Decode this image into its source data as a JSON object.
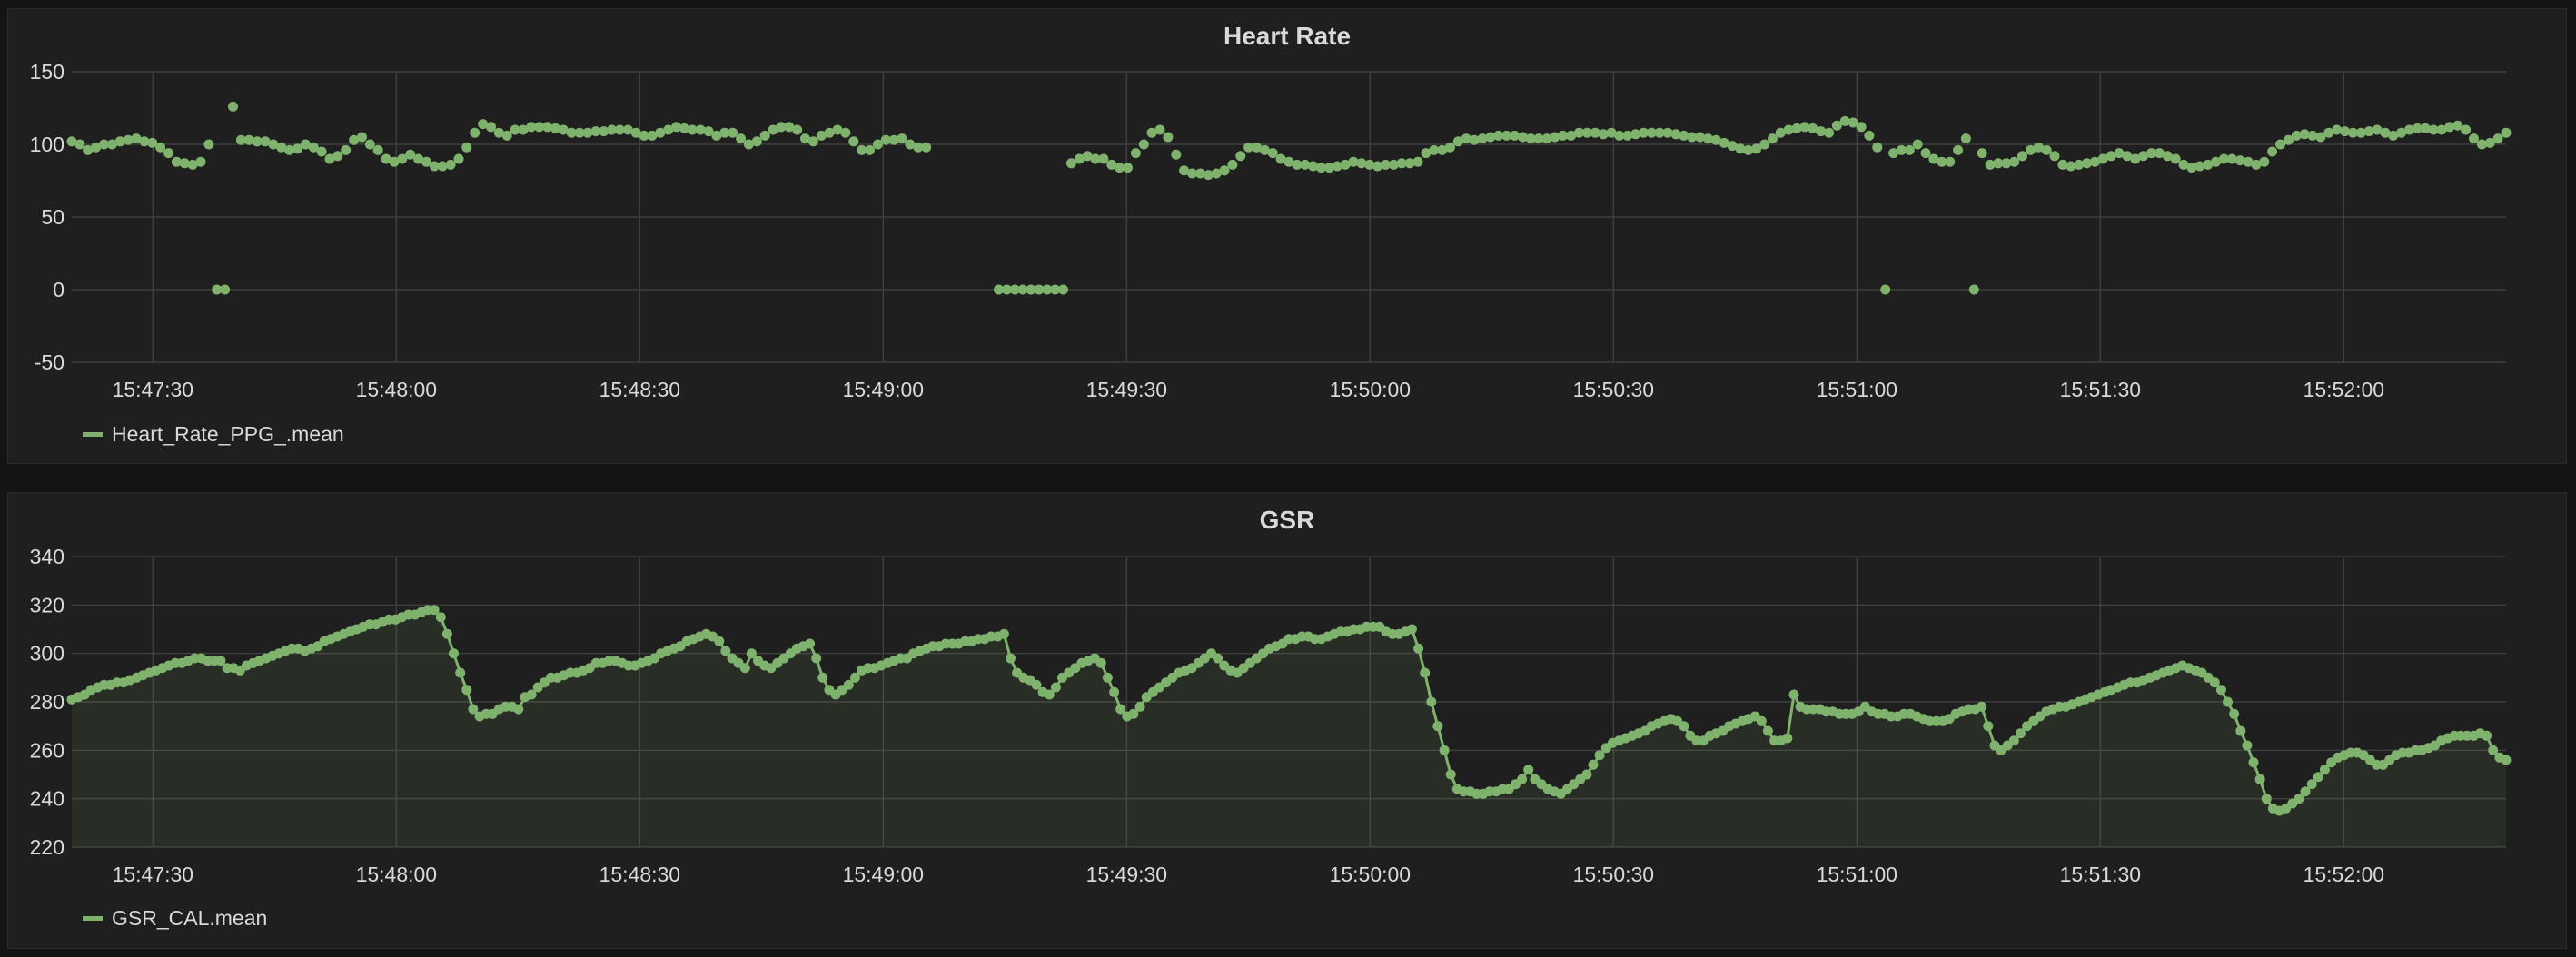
{
  "chart_data": [
    {
      "type": "scatter",
      "title": "Heart Rate",
      "ylim": [
        -50,
        150
      ],
      "yticks": [
        "150",
        "100",
        "50",
        "0",
        "-50"
      ],
      "xticks": [
        "15:47:30",
        "15:48:00",
        "15:48:30",
        "15:49:00",
        "15:49:30",
        "15:50:00",
        "15:50:30",
        "15:51:00",
        "15:51:30",
        "15:52:00"
      ],
      "x_start": "15:47:20",
      "x_end": "15:52:20",
      "grid": true,
      "legend_position": "bottom-left",
      "series": [
        {
          "name": "Heart_Rate_PPG_.mean",
          "color": "#7eb26d",
          "values": [
            102,
            100,
            96,
            98,
            100,
            100,
            102,
            103,
            104,
            102,
            101,
            98,
            94,
            88,
            87,
            86,
            88,
            100,
            0,
            0,
            126,
            103,
            103,
            102,
            102,
            100,
            98,
            96,
            97,
            100,
            98,
            95,
            90,
            92,
            96,
            103,
            105,
            100,
            96,
            90,
            88,
            90,
            93,
            90,
            88,
            85,
            85,
            86,
            90,
            98,
            108,
            114,
            112,
            108,
            106,
            110,
            110,
            112,
            112,
            112,
            111,
            110,
            108,
            108,
            108,
            109,
            109,
            110,
            110,
            110,
            108,
            106,
            106,
            108,
            110,
            112,
            111,
            110,
            110,
            109,
            106,
            108,
            108,
            104,
            100,
            102,
            106,
            110,
            112,
            112,
            110,
            104,
            102,
            106,
            108,
            110,
            108,
            102,
            96,
            96,
            100,
            103,
            103,
            104,
            100,
            98,
            98,
            null,
            null,
            null,
            null,
            null,
            null,
            null,
            null,
            0,
            0,
            0,
            0,
            0,
            0,
            0,
            0,
            0,
            87,
            90,
            92,
            90,
            90,
            86,
            84,
            84,
            94,
            100,
            108,
            110,
            105,
            93,
            82,
            80,
            80,
            79,
            80,
            82,
            86,
            92,
            98,
            98,
            96,
            94,
            90,
            88,
            86,
            86,
            85,
            84,
            84,
            85,
            86,
            88,
            87,
            86,
            85,
            86,
            86,
            87,
            87,
            88,
            94,
            96,
            96,
            98,
            102,
            104,
            103,
            104,
            105,
            106,
            106,
            106,
            105,
            104,
            104,
            104,
            105,
            106,
            106,
            108,
            108,
            108,
            107,
            108,
            106,
            106,
            107,
            108,
            108,
            108,
            108,
            107,
            106,
            105,
            105,
            104,
            103,
            101,
            99,
            97,
            96,
            97,
            100,
            104,
            108,
            110,
            111,
            112,
            111,
            109,
            108,
            113,
            116,
            115,
            112,
            106,
            98,
            0,
            94,
            96,
            96,
            100,
            94,
            90,
            88,
            88,
            96,
            104,
            0,
            94,
            86,
            87,
            87,
            88,
            92,
            96,
            98,
            96,
            92,
            86,
            85,
            86,
            87,
            88,
            90,
            92,
            94,
            92,
            90,
            92,
            94,
            94,
            92,
            90,
            86,
            84,
            85,
            86,
            88,
            90,
            90,
            89,
            88,
            86,
            88,
            95,
            100,
            103,
            106,
            107,
            106,
            105,
            108,
            110,
            109,
            108,
            108,
            109,
            110,
            108,
            106,
            108,
            110,
            111,
            111,
            110,
            110,
            112,
            113,
            110,
            104,
            100,
            101,
            104,
            108
          ]
        }
      ]
    },
    {
      "type": "area",
      "title": "GSR",
      "ylim": [
        220,
        340
      ],
      "yticks": [
        "340",
        "320",
        "300",
        "280",
        "260",
        "240",
        "220"
      ],
      "xticks": [
        "15:47:30",
        "15:48:00",
        "15:48:30",
        "15:49:00",
        "15:49:30",
        "15:50:00",
        "15:50:30",
        "15:51:00",
        "15:51:30",
        "15:52:00"
      ],
      "x_start": "15:47:20",
      "x_end": "15:52:20",
      "grid": true,
      "legend_position": "bottom-left",
      "series": [
        {
          "name": "GSR_CAL.mean",
          "color": "#7eb26d",
          "values": [
            281,
            282,
            283,
            285,
            286,
            287,
            287,
            288,
            288,
            289,
            290,
            291,
            292,
            293,
            294,
            295,
            296,
            296,
            297,
            298,
            298,
            297,
            297,
            297,
            294,
            294,
            293,
            295,
            296,
            297,
            298,
            299,
            300,
            301,
            302,
            302,
            301,
            302,
            303,
            305,
            306,
            307,
            308,
            309,
            310,
            311,
            312,
            312,
            313,
            314,
            314,
            315,
            316,
            316,
            317,
            318,
            318,
            315,
            308,
            300,
            292,
            285,
            277,
            274,
            275,
            275,
            277,
            278,
            278,
            277,
            282,
            283,
            286,
            288,
            290,
            290,
            291,
            292,
            292,
            293,
            294,
            296,
            296,
            297,
            297,
            296,
            295,
            295,
            296,
            297,
            298,
            300,
            301,
            302,
            303,
            305,
            306,
            307,
            308,
            307,
            305,
            301,
            298,
            296,
            294,
            300,
            297,
            295,
            294,
            296,
            298,
            300,
            302,
            303,
            304,
            298,
            290,
            285,
            283,
            285,
            287,
            290,
            293,
            294,
            294,
            295,
            296,
            297,
            298,
            298,
            300,
            301,
            302,
            303,
            303,
            304,
            304,
            304,
            305,
            305,
            306,
            306,
            307,
            307,
            308,
            298,
            292,
            290,
            289,
            287,
            284,
            283,
            286,
            290,
            292,
            294,
            296,
            297,
            298,
            296,
            290,
            284,
            277,
            274,
            275,
            278,
            282,
            284,
            286,
            288,
            290,
            292,
            293,
            294,
            296,
            298,
            300,
            298,
            295,
            293,
            292,
            294,
            296,
            298,
            300,
            302,
            303,
            304,
            306,
            306,
            307,
            307,
            306,
            306,
            307,
            308,
            309,
            309,
            310,
            310,
            311,
            311,
            311,
            309,
            308,
            308,
            309,
            310,
            302,
            292,
            280,
            270,
            260,
            250,
            244,
            243,
            243,
            242,
            242,
            243,
            243,
            244,
            244,
            246,
            248,
            252,
            248,
            246,
            244,
            243,
            242,
            244,
            246,
            248,
            250,
            254,
            258,
            261,
            263,
            264,
            265,
            266,
            267,
            268,
            270,
            271,
            272,
            273,
            272,
            270,
            266,
            264,
            264,
            266,
            267,
            268,
            270,
            271,
            272,
            273,
            274,
            272,
            268,
            264,
            264,
            265,
            283,
            278,
            277,
            277,
            277,
            276,
            276,
            275,
            275,
            275,
            276,
            278,
            276,
            275,
            275,
            274,
            274,
            275,
            275,
            274,
            273,
            272,
            272,
            272,
            273,
            275,
            276,
            277,
            277,
            278,
            270,
            262,
            260,
            262,
            264,
            267,
            270,
            272,
            274,
            276,
            277,
            278,
            278,
            279,
            280,
            281,
            282,
            283,
            284,
            285,
            286,
            287,
            288,
            288,
            289,
            290,
            291,
            292,
            293,
            294,
            295,
            294,
            293,
            292,
            290,
            288,
            285,
            280,
            275,
            268,
            262,
            255,
            248,
            240,
            236,
            235,
            236,
            238,
            240,
            243,
            246,
            249,
            252,
            255,
            257,
            258,
            259,
            259,
            258,
            256,
            254,
            254,
            256,
            258,
            259,
            259,
            260,
            260,
            261,
            262,
            264,
            265,
            266,
            266,
            266,
            266,
            267,
            266,
            260,
            257,
            256
          ]
        }
      ]
    }
  ]
}
